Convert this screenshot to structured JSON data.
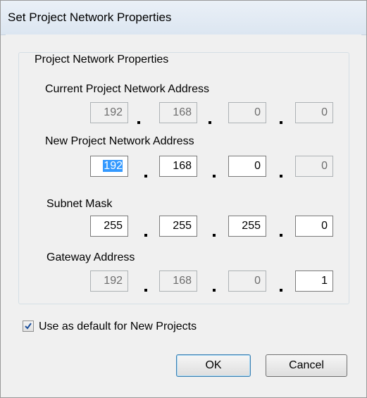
{
  "window": {
    "title": "Set Project Network Properties"
  },
  "group": {
    "legend": "Project Network Properties"
  },
  "fields": {
    "current": {
      "label": "Current Project Network Address",
      "octets": [
        "192",
        "168",
        "0",
        "0"
      ],
      "enabled": [
        false,
        false,
        false,
        false
      ]
    },
    "new": {
      "label": "New Project Network Address",
      "octets": [
        "192",
        "168",
        "0",
        "0"
      ],
      "enabled": [
        true,
        true,
        true,
        false
      ],
      "selected_octet": 0
    },
    "subnet": {
      "label": "Subnet Mask",
      "octets": [
        "255",
        "255",
        "255",
        "0"
      ],
      "enabled": [
        true,
        true,
        true,
        true
      ]
    },
    "gateway": {
      "label": "Gateway Address",
      "octets": [
        "192",
        "168",
        "0",
        "1"
      ],
      "enabled": [
        false,
        false,
        false,
        true
      ]
    }
  },
  "default_checkbox": {
    "label": "Use as default for New Projects",
    "checked": true
  },
  "buttons": {
    "ok": "OK",
    "cancel": "Cancel"
  },
  "colors": {
    "selection": "#3399ff",
    "check": "#1b4f9c"
  }
}
